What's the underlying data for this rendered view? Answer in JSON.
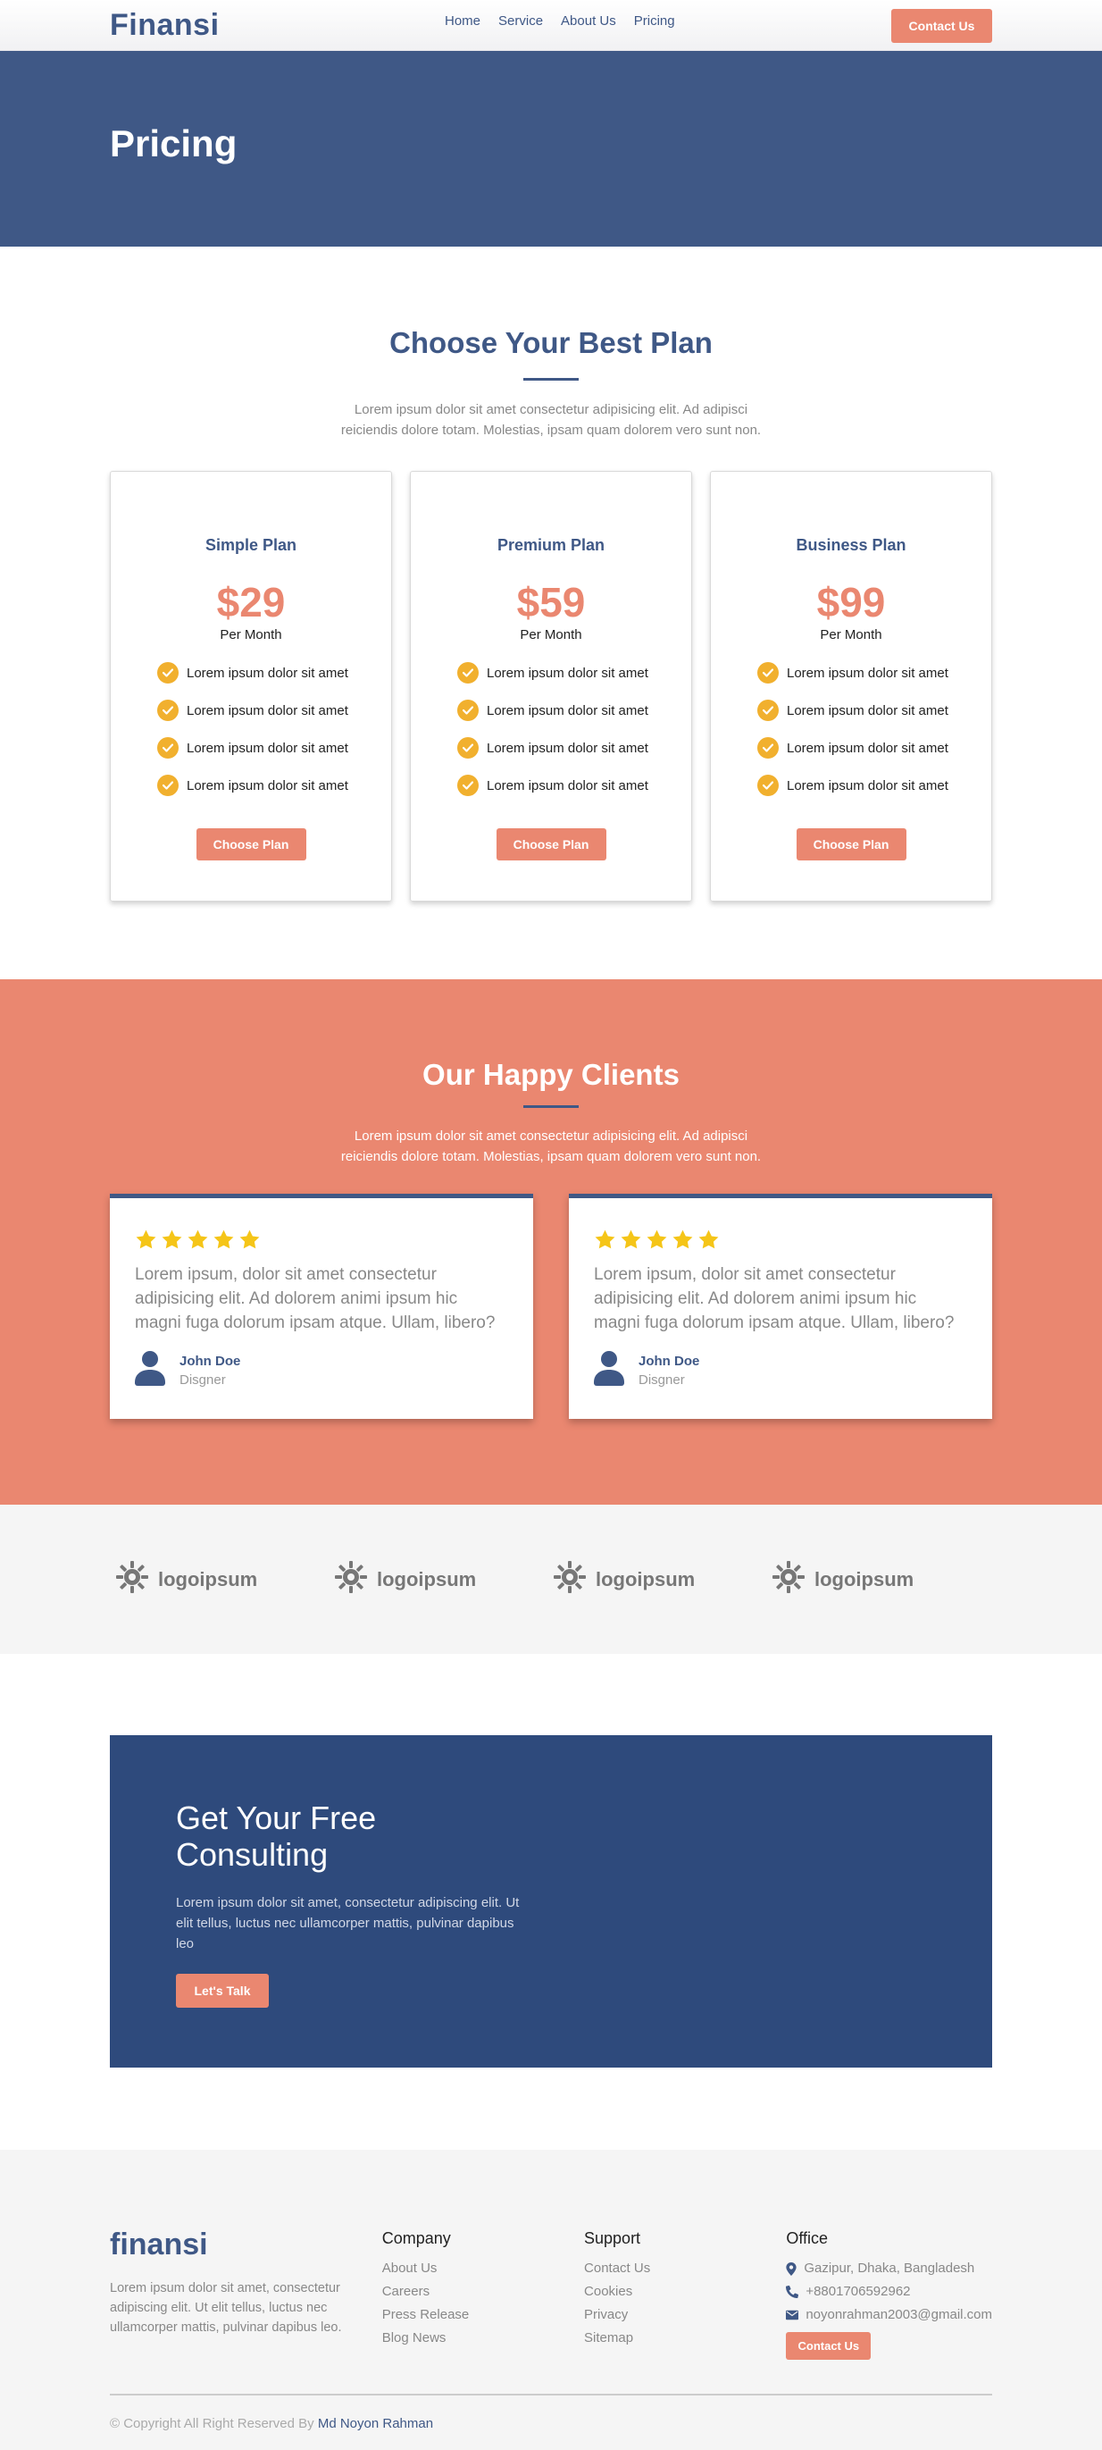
{
  "nav": {
    "brand": "Finansi",
    "links": [
      "Home",
      "Service",
      "About Us",
      "Pricing"
    ],
    "cta": "Contact Us"
  },
  "hero": {
    "title": "Pricing"
  },
  "pricing": {
    "title": "Choose Your Best Plan",
    "subtitle": "Lorem ipsum dolor sit amet consectetur adipisicing elit. Ad adipisci reiciendis dolore totam. Molestias, ipsam quam dolorem vero sunt non.",
    "plans": [
      {
        "name": "Simple Plan",
        "price": "$29",
        "period": "Per Month",
        "features": [
          "Lorem ipsum dolor sit amet",
          "Lorem ipsum dolor sit amet",
          "Lorem ipsum dolor sit amet",
          "Lorem ipsum dolor sit amet"
        ],
        "button": "Choose Plan"
      },
      {
        "name": "Premium Plan",
        "price": "$59",
        "period": "Per Month",
        "features": [
          "Lorem ipsum dolor sit amet",
          "Lorem ipsum dolor sit amet",
          "Lorem ipsum dolor sit amet",
          "Lorem ipsum dolor sit amet"
        ],
        "button": "Choose Plan"
      },
      {
        "name": "Business Plan",
        "price": "$99",
        "period": "Per Month",
        "features": [
          "Lorem ipsum dolor sit amet",
          "Lorem ipsum dolor sit amet",
          "Lorem ipsum dolor sit amet",
          "Lorem ipsum dolor sit amet"
        ],
        "button": "Choose Plan"
      }
    ]
  },
  "clients": {
    "title": "Our Happy Clients",
    "subtitle": "Lorem ipsum dolor sit amet consectetur adipisicing elit. Ad adipisci reiciendis dolore totam. Molestias, ipsam quam dolorem vero sunt non.",
    "testimonials": [
      {
        "rating": 5,
        "text": "Lorem ipsum, dolor sit amet consectetur adipisicing elit. Ad dolorem animi ipsum hic magni fuga dolorum ipsam atque. Ullam, libero?",
        "name": "John Doe",
        "role": "Disgner"
      },
      {
        "rating": 5,
        "text": "Lorem ipsum, dolor sit amet consectetur adipisicing elit. Ad dolorem animi ipsum hic magni fuga dolorum ipsam atque. Ullam, libero?",
        "name": "John Doe",
        "role": "Disgner"
      }
    ]
  },
  "logos": [
    "logoipsum",
    "logoipsum",
    "logoipsum",
    "logoipsum"
  ],
  "cta": {
    "title": "Get Your Free Consulting",
    "text": "Lorem ipsum dolor sit amet, consectetur adipiscing elit. Ut elit tellus, luctus nec ullamcorper mattis, pulvinar dapibus leo",
    "button": "Let's Talk"
  },
  "footer": {
    "brand": "finansi",
    "description": "Lorem ipsum dolor sit amet, consectetur adipiscing elit. Ut elit tellus, luctus nec ullamcorper mattis, pulvinar dapibus leo.",
    "company": {
      "heading": "Company",
      "links": [
        "About Us",
        "Careers",
        "Press Release",
        "Blog News"
      ]
    },
    "support": {
      "heading": "Support",
      "links": [
        "Contact Us",
        "Cookies",
        "Privacy",
        "Sitemap"
      ]
    },
    "office": {
      "heading": "Office",
      "address": "Gazipur, Dhaka, Bangladesh",
      "phone": "+8801706592962",
      "email": "noyonrahman2003@gmail.com",
      "button": "Contact Us"
    },
    "copyright": "© Copyright All Right Reserved By ",
    "author": "Md Noyon Rahman"
  },
  "colors": {
    "primary": "#3f5886",
    "accent": "#ea8770",
    "cta_bg": "#2e4a7c",
    "check": "#f1b02e",
    "star": "#f5c518"
  },
  "icons": [
    "check-circle-icon",
    "star-icon",
    "user-icon",
    "sun-logo-icon",
    "map-marker-icon",
    "phone-icon",
    "envelope-icon"
  ]
}
